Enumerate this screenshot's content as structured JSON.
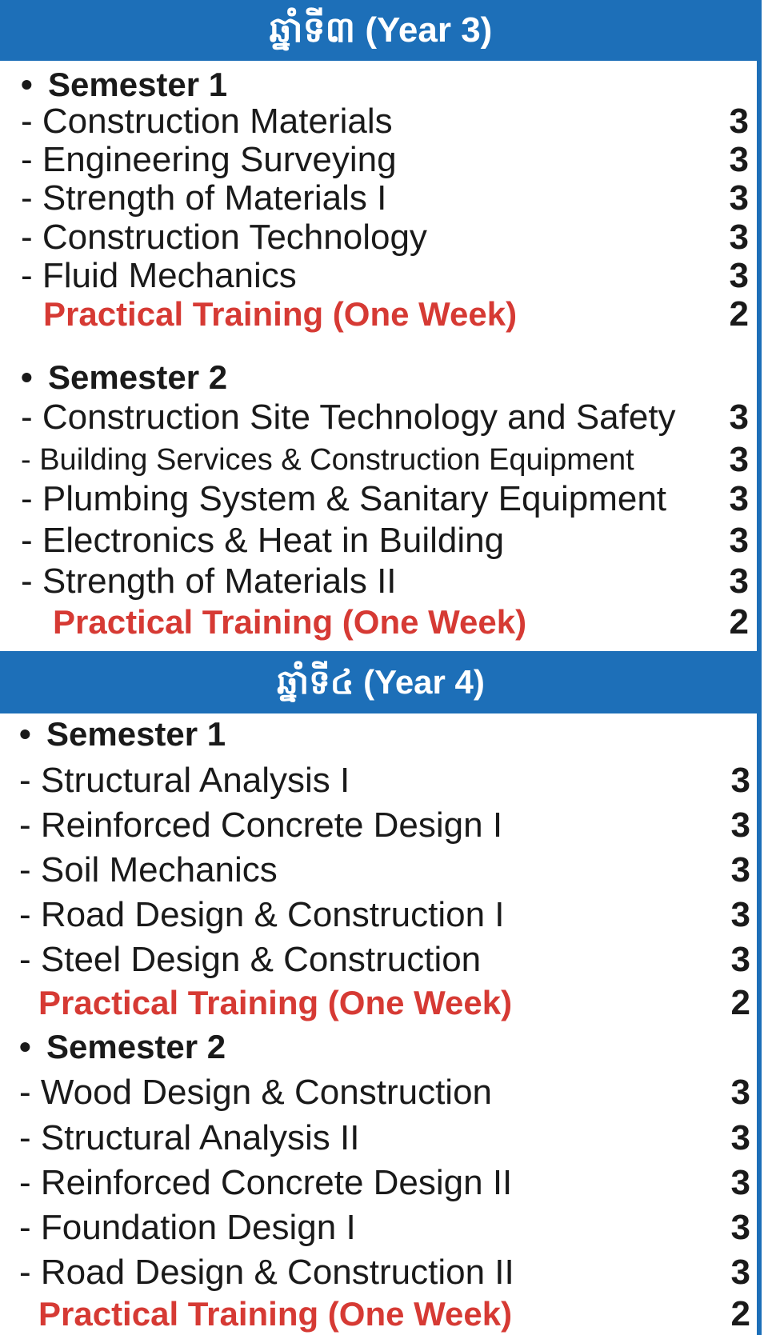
{
  "year3": {
    "title_khmer": "ឆ្នាំទី៣",
    "title_en": "(Year 3)",
    "semester1": {
      "label": "Semester 1",
      "courses": [
        {
          "name": "- Construction Materials",
          "credits": "3"
        },
        {
          "name": "- Engineering Surveying",
          "credits": "3"
        },
        {
          "name": "- Strength of Materials I",
          "credits": "3"
        },
        {
          "name": "- Construction Technology",
          "credits": "3"
        },
        {
          "name": "- Fluid Mechanics",
          "credits": "3"
        }
      ],
      "practical": {
        "name": "Practical Training (One Week)",
        "credits": "2"
      }
    },
    "semester2": {
      "label": "Semester 2",
      "courses": [
        {
          "name": "- Construction Site Technology and Safety",
          "credits": "3"
        },
        {
          "name": "- Building Services & Construction Equipment",
          "credits": "3"
        },
        {
          "name": "- Plumbing System & Sanitary Equipment",
          "credits": "3"
        },
        {
          "name": "- Electronics & Heat in Building",
          "credits": "3"
        },
        {
          "name": "- Strength of Materials II",
          "credits": "3"
        }
      ],
      "practical": {
        "name": "Practical Training (One Week)",
        "credits": "2"
      }
    }
  },
  "year4": {
    "title_khmer": "ឆ្នាំទី៤",
    "title_en": "(Year 4)",
    "semester1": {
      "label": "Semester 1",
      "courses": [
        {
          "name": "- Structural Analysis I",
          "credits": "3"
        },
        {
          "name": "- Reinforced Concrete Design I",
          "credits": "3"
        },
        {
          "name": "- Soil Mechanics",
          "credits": "3"
        },
        {
          "name": "- Road Design & Construction I",
          "credits": "3"
        },
        {
          "name": "- Steel Design & Construction",
          "credits": "3"
        }
      ],
      "practical": {
        "name": "Practical Training (One Week)",
        "credits": "2"
      }
    },
    "semester2": {
      "label": "Semester 2",
      "courses": [
        {
          "name": "- Wood Design & Construction",
          "credits": "3"
        },
        {
          "name": "- Structural Analysis II",
          "credits": "3"
        },
        {
          "name": "- Reinforced Concrete Design II",
          "credits": "3"
        },
        {
          "name": "- Foundation Design I",
          "credits": "3"
        },
        {
          "name": "- Road Design & Construction II",
          "credits": "3"
        }
      ],
      "practical": {
        "name": "Practical Training (One Week)",
        "credits": "2"
      }
    }
  },
  "colors": {
    "header_blue": "#1d6fb8",
    "practical_red": "#d63a34"
  }
}
